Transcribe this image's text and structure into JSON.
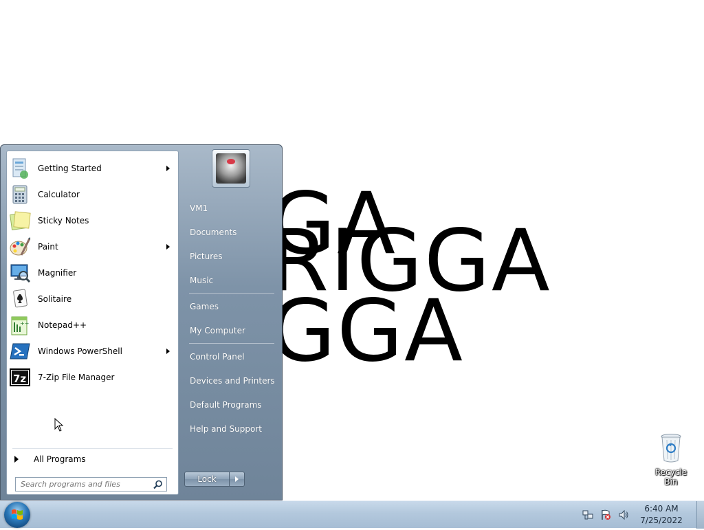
{
  "desktop": {
    "wallpaper_text": [
      "GA",
      "RIGGA",
      "GGA"
    ],
    "recycle_bin_label": "Recycle Bin"
  },
  "start_menu": {
    "programs": [
      {
        "label": "Getting Started",
        "icon": "getting-started-icon",
        "submenu": true
      },
      {
        "label": "Calculator",
        "icon": "calculator-icon",
        "submenu": false
      },
      {
        "label": "Sticky Notes",
        "icon": "sticky-notes-icon",
        "submenu": false
      },
      {
        "label": "Paint",
        "icon": "paint-icon",
        "submenu": true
      },
      {
        "label": "Magnifier",
        "icon": "magnifier-icon",
        "submenu": false
      },
      {
        "label": "Solitaire",
        "icon": "solitaire-icon",
        "submenu": false
      },
      {
        "label": "Notepad++",
        "icon": "notepadpp-icon",
        "submenu": false
      },
      {
        "label": "Windows PowerShell",
        "icon": "powershell-icon",
        "submenu": true
      },
      {
        "label": "7-Zip File Manager",
        "icon": "7zip-icon",
        "submenu": false
      }
    ],
    "all_programs": "All Programs",
    "search_placeholder": "Search programs and files",
    "right_items": [
      {
        "label": "VM1"
      },
      {
        "label": "Documents"
      },
      {
        "label": "Pictures"
      },
      {
        "label": "Music"
      },
      {
        "label": "Games"
      },
      {
        "label": "My Computer"
      },
      {
        "label": "Control Panel"
      },
      {
        "label": "Devices and Printers"
      },
      {
        "label": "Default Programs"
      },
      {
        "label": "Help and Support"
      }
    ],
    "lock_label": "Lock"
  },
  "taskbar": {
    "time": "6:40 AM",
    "date": "7/25/2022"
  },
  "colors": {
    "start_menu_accent": "#7e93a8",
    "taskbar": "#b3c8dd"
  }
}
